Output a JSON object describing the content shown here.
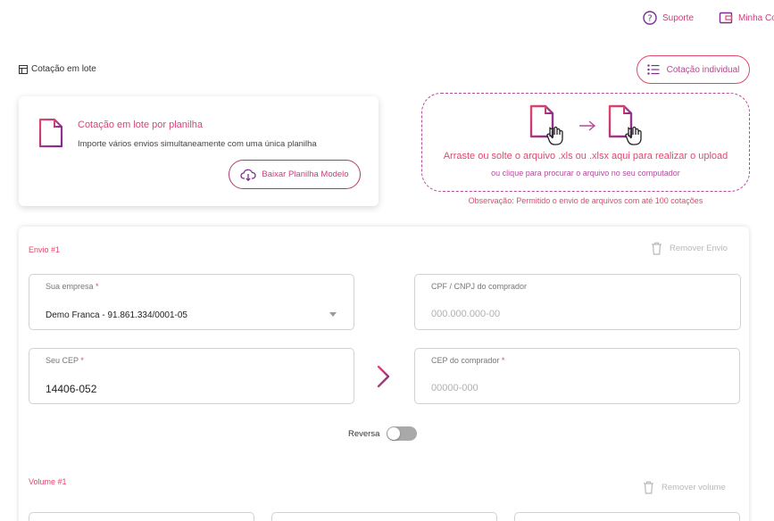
{
  "header": {
    "support_label": "Suporte",
    "account_label": "Minha Conta"
  },
  "page": {
    "title": "Cotação em lote",
    "individual_button": "Cotação individual"
  },
  "planilha_card": {
    "title": "Cotação em lote por planilha",
    "description": "Importe vários envios simultaneamente com uma única planilha",
    "download_button": "Baixar Planilha Modelo"
  },
  "dropzone": {
    "main_text": "Arraste ou solte o arquivo .xls ou .xlsx aqui para realizar o upload",
    "sub_text": "ou clique para procurar o arquivo no seu computador",
    "note": "Observação: Permitido o envio de arquivos com até 100 cotações"
  },
  "envio": {
    "label": "Envio #1",
    "remove_label": "Remover Envio",
    "empresa": {
      "label": "Sua empresa",
      "required": "*",
      "value": "Demo Franca - 91.861.334/0001-05"
    },
    "cpf": {
      "label": "CPF / CNPJ do comprador",
      "placeholder": "000.000.000-00"
    },
    "seu_cep": {
      "label": "Seu CEP",
      "required": "*",
      "value": "14406-052"
    },
    "cep_comprador": {
      "label": "CEP do comprador",
      "required": "*",
      "placeholder": "00000-000"
    },
    "reversa_label": "Reversa",
    "reversa_on": false
  },
  "volume": {
    "label": "Volume #1",
    "remove_label": "Remover volume"
  },
  "colors": {
    "accent_pink": "#e0486e",
    "accent_purple": "#7b2d8e",
    "text_muted": "#b8b8b8"
  }
}
